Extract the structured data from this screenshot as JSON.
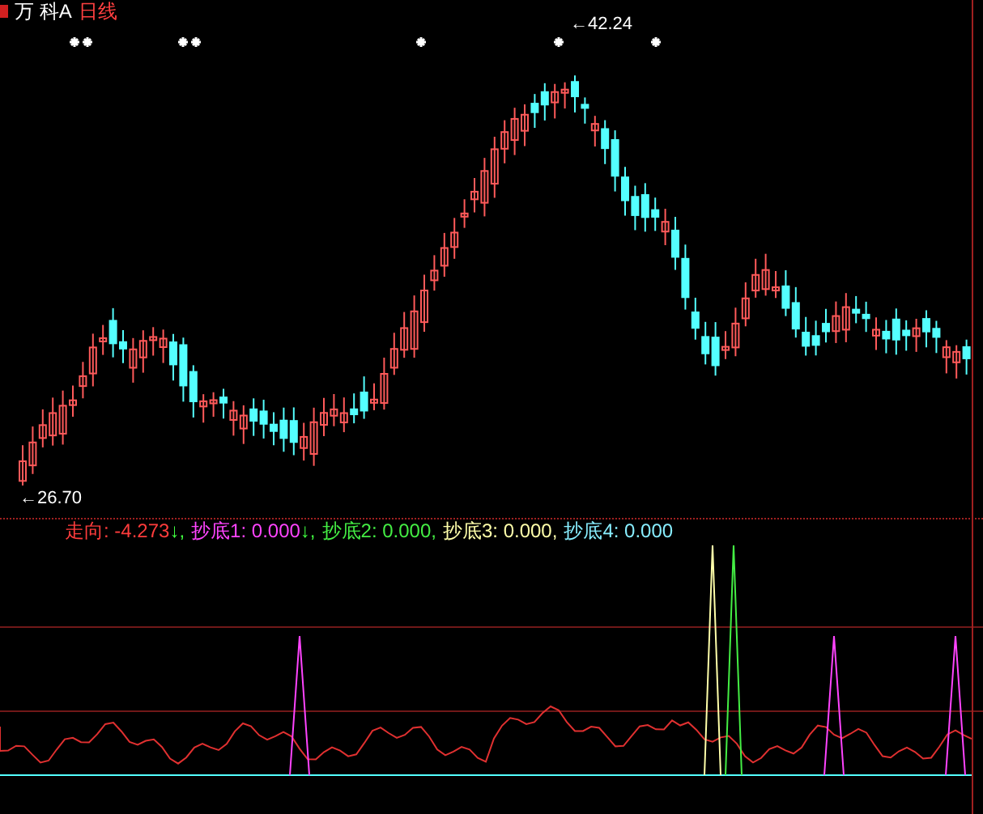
{
  "title": {
    "stock": "万 科A",
    "period": "日线"
  },
  "price_labels": [
    {
      "kind": "high",
      "text": "←42.24"
    },
    {
      "kind": "low",
      "text": "←26.70"
    }
  ],
  "indicator": {
    "items": [
      {
        "text": "走向: -4.273",
        "arrow": "↓,",
        "color": "#ff3c3c"
      },
      {
        "text": "抄底1: 0.000",
        "arrow": "↓,",
        "color": "#ff44ff"
      },
      {
        "text": "抄底2: 0.000,",
        "color": "#44ee44"
      },
      {
        "text": "抄底3: 0.000,",
        "color": "#ffffaa"
      },
      {
        "text": "抄底4: 0.000",
        "color": "#88eeff"
      }
    ]
  }
}
